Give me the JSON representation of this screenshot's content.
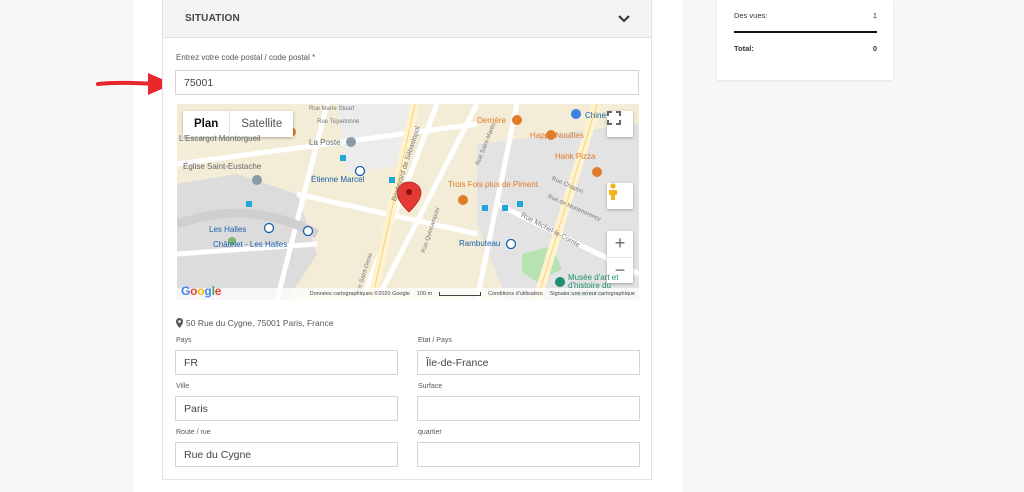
{
  "colors": {
    "accent_arrow": "#e8262b",
    "map_bg": "#f3ecd7",
    "marker": "#e53935",
    "metro": "#1b5fa8",
    "food": "#e07b2c"
  },
  "situation": {
    "title": "SITUATION",
    "toggle_icon": "chevron-down-icon",
    "postal_label": "Entrez votre code postal / code postal *",
    "postal_value": "75001"
  },
  "map": {
    "tab_plan": "Plan",
    "tab_satellite": "Satellite",
    "labels": {
      "rue_marie_stuart": "Rue Marie Stuart",
      "rue_tiquetonne": "Rue Tiquetonne",
      "escargot": "L'Escargot Montorgueil",
      "la_poste": "La Poste",
      "eglise": "Église Saint-Eustache",
      "etienne_marcel": "Étienne Marcel",
      "les_halles": "Les Halles",
      "chatelet": "Châtelet - Les Halles",
      "derriere": "Derrière",
      "happy_nouilles": "Happy Nouilles",
      "hank_pizza": "Hank Pizza",
      "trois_fois": "Trois Fois plus de Piment",
      "rambuteau": "Rambuteau",
      "boulevard": "Boulevard de Sébastopol",
      "rue_quincampoix": "Rue Quincampoix",
      "rue_saint_denis": "Rue Saint-Denis",
      "rue_michel": "Rue Michel-le-Comte",
      "rue_montmorency": "Rue de Montmorency",
      "rue_chapon": "Rue Chapon",
      "rue_saint_martin": "Rue Saint-Martin",
      "musee": "Musée d'art et d'histoire du Judaïsme",
      "chine": "Chine"
    },
    "footer": {
      "google": "Google",
      "data": "Données cartographiques ©2020 Google",
      "scale": "100 m",
      "terms": "Conditions d'utilisation",
      "report": "Signaler une erreur cartographique"
    }
  },
  "address": {
    "icon": "map-pin-icon",
    "text": "50 Rue du Cygne, 75001 Paris, France"
  },
  "fields": {
    "pays_label": "Pays",
    "pays_value": "FR",
    "etat_label": "Etat / Pays",
    "etat_value": "Île-de-France",
    "ville_label": "Ville",
    "ville_value": "Paris",
    "surface_label": "Surface",
    "surface_value": "",
    "route_label": "Route / rue",
    "route_value": "Rue du Cygne",
    "quartier_label": "quartier",
    "quartier_value": ""
  },
  "sidebar": {
    "views_label": "Des vues:",
    "views_value": "1",
    "total_label": "Total:",
    "total_value": "0"
  }
}
